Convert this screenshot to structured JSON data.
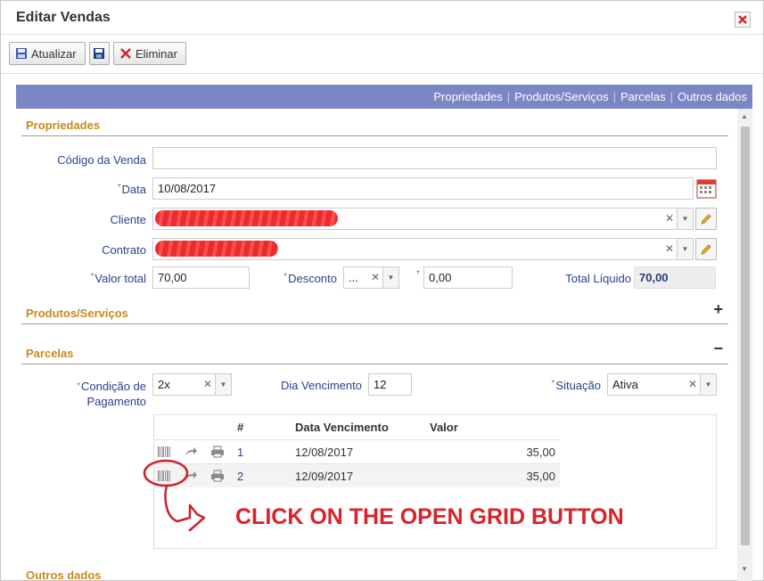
{
  "window": {
    "title": "Editar Vendas"
  },
  "toolbar": {
    "update_label": "Atualizar",
    "delete_label": "Eliminar"
  },
  "nav": {
    "tabs": [
      "Propriedades",
      "Produtos/Serviços",
      "Parcelas",
      "Outros dados"
    ]
  },
  "sections": {
    "propriedades": "Propriedades",
    "produtos": "Produtos/Serviços",
    "parcelas": "Parcelas",
    "outros": "Outros dados"
  },
  "form": {
    "codigo_label": "Código da Venda",
    "codigo_value": "",
    "data_label": "Data",
    "data_value": "10/08/2017",
    "cliente_label": "Cliente",
    "contrato_label": "Contrato",
    "valor_total_label": "Valor total",
    "valor_total_value": "70,00",
    "desconto_label": "Desconto",
    "desconto_select": "...",
    "desconto_value": "0,00",
    "total_liquido_label": "Total Líquido",
    "total_liquido_value": "70,00"
  },
  "parcelas": {
    "condicao_label_1": "Condição de",
    "condicao_label_2": "Pagamento",
    "condicao_value": "2x",
    "dia_venc_label": "Dia Vencimento",
    "dia_venc_value": "12",
    "situacao_label": "Situação",
    "situacao_value": "Ativa",
    "grid": {
      "headers": [
        "#",
        "Data Vencimento",
        "Valor"
      ],
      "rows": [
        {
          "num": "1",
          "date": "12/08/2017",
          "value": "35,00"
        },
        {
          "num": "2",
          "date": "12/09/2017",
          "value": "35,00"
        }
      ]
    }
  },
  "annotation": {
    "text": "CLICK ON THE OPEN GRID BUTTON"
  },
  "colors": {
    "accent": "#7b86c4",
    "section": "#c9891b",
    "label": "#274390",
    "annotation": "#d9222a"
  }
}
